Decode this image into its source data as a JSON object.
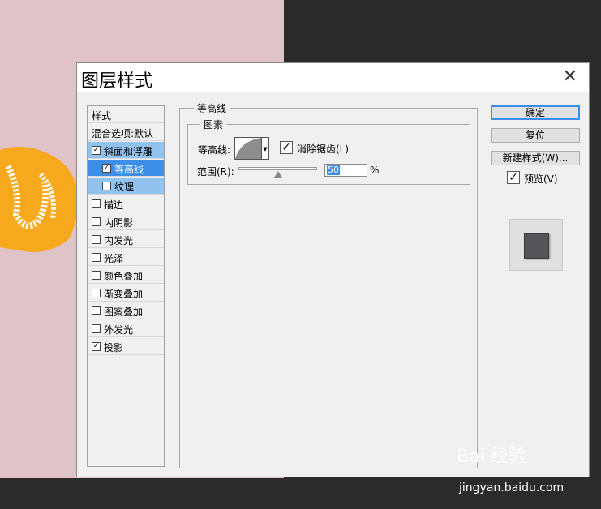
{
  "dialog": {
    "title": "图层样式",
    "close_glyph": "✕"
  },
  "styles_list": {
    "header": "样式",
    "blend_options": "混合选项:默认",
    "items": [
      {
        "label": "斜面和浮雕",
        "checked": true
      },
      {
        "label": "等高线",
        "checked": true
      },
      {
        "label": "纹理",
        "checked": false
      },
      {
        "label": "描边",
        "checked": false
      },
      {
        "label": "内阴影",
        "checked": false
      },
      {
        "label": "内发光",
        "checked": false
      },
      {
        "label": "光泽",
        "checked": false
      },
      {
        "label": "颜色叠加",
        "checked": false
      },
      {
        "label": "渐变叠加",
        "checked": false
      },
      {
        "label": "图案叠加",
        "checked": false
      },
      {
        "label": "外发光",
        "checked": false
      },
      {
        "label": "投影",
        "checked": true
      }
    ]
  },
  "contour_panel": {
    "group_title": "等高线",
    "subgroup_title": "图素",
    "contour_label": "等高线:",
    "antialias_label": "消除锯齿(L)",
    "antialias_checked": true,
    "range_label": "范围(R):",
    "range_value": "50",
    "range_unit": "%"
  },
  "buttons": {
    "ok": "确定",
    "reset": "复位",
    "new_style": "新建样式(W)..."
  },
  "preview": {
    "label": "预览(V)",
    "checked": true
  },
  "watermark": {
    "brand": "Bai 经验",
    "url": "jingyan.baidu.com"
  },
  "colors": {
    "selection_light": "#92c2ee",
    "selection_strong": "#3d8ee6",
    "canvas_pink": "#dfc3c8"
  }
}
